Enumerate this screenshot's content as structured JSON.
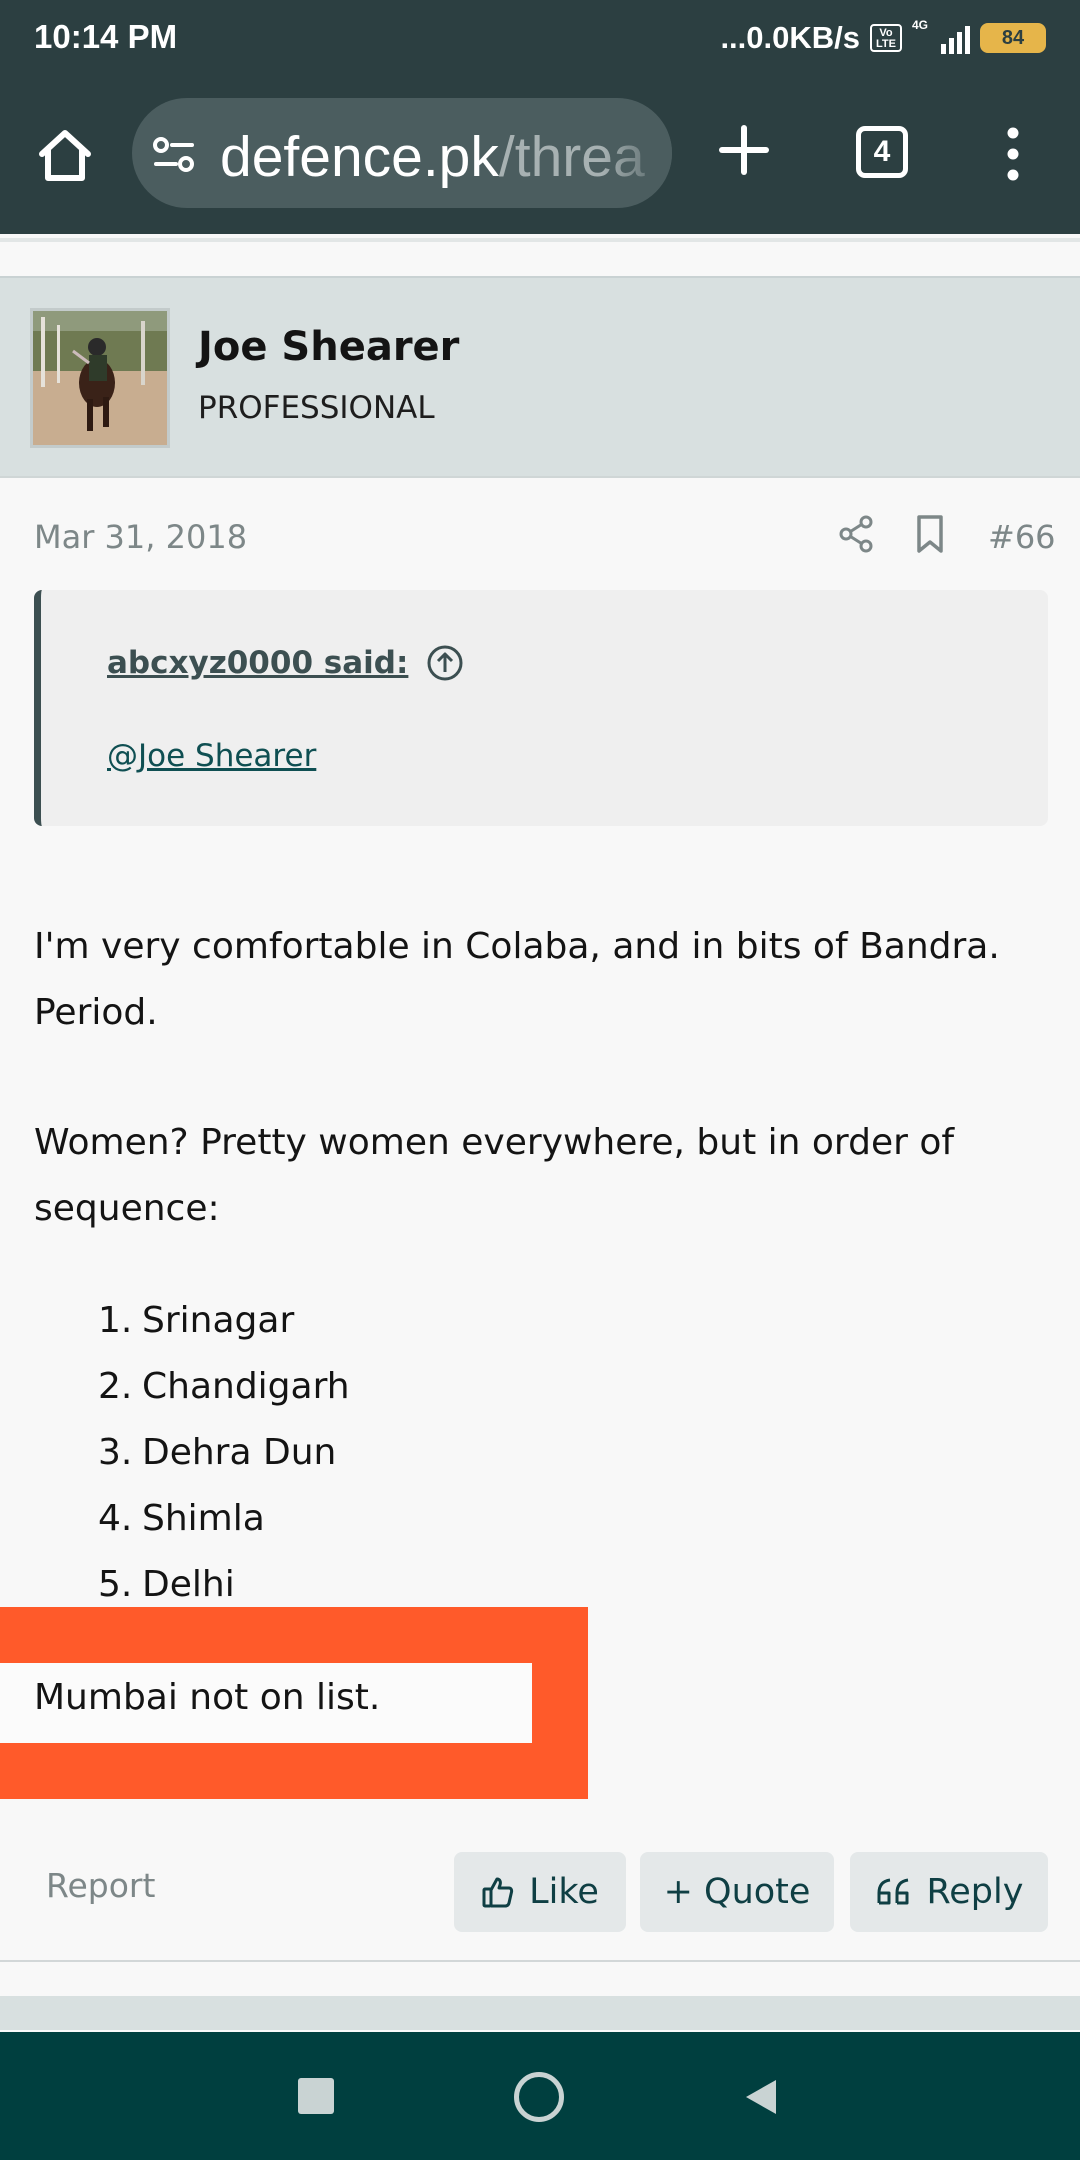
{
  "status_bar": {
    "time": "10:14 PM",
    "net_speed": "...0.0KB/s",
    "volte": "Vo\nLTE",
    "network_type": "4G",
    "battery": "84"
  },
  "browser": {
    "url_host": "defence.pk",
    "url_path": "/threa",
    "tab_count": "4"
  },
  "post": {
    "author": "Joe Shearer",
    "author_title": "PROFESSIONAL",
    "date": "Mar 31, 2018",
    "number": "#66",
    "quote": {
      "author_line": "abcxyz0000 said:",
      "text": "@Joe Shearer"
    },
    "paragraph1": "I'm very comfortable in Colaba, and in bits of Bandra. Period.",
    "paragraph2": "Women? Pretty women everywhere, but in order of sequence:",
    "list": [
      {
        "num": "1.",
        "city": "Srinagar"
      },
      {
        "num": "2.",
        "city": "Chandigarh"
      },
      {
        "num": "3.",
        "city": "Dehra Dun"
      },
      {
        "num": "4.",
        "city": "Shimla"
      },
      {
        "num": "5.",
        "city": "Delhi"
      }
    ],
    "highlighted_text": "Mumbai not on list."
  },
  "actions": {
    "report": "Report",
    "like": "Like",
    "quote": "+ Quote",
    "reply": "Reply"
  },
  "colors": {
    "toolbar": "#2c3f41",
    "header_bg": "#d8e0e0",
    "highlight": "#ff5a2a",
    "nav_bar": "#003f3f"
  }
}
